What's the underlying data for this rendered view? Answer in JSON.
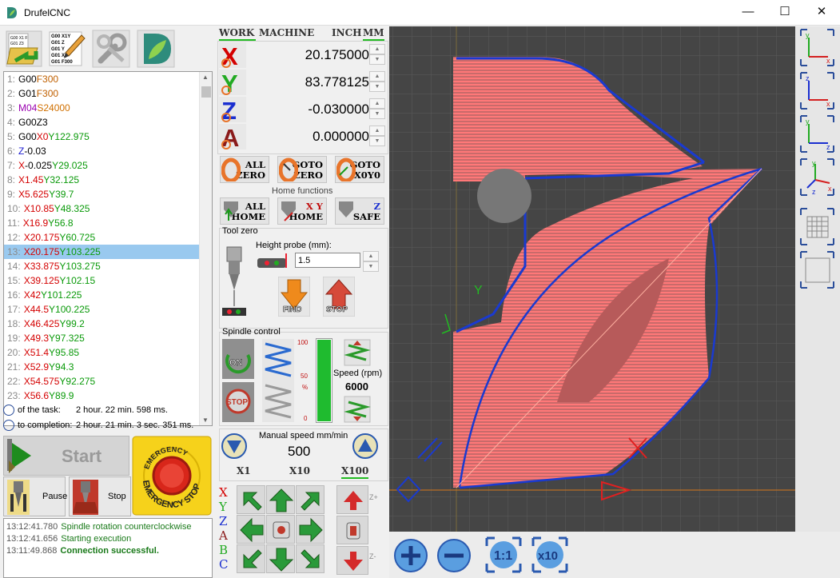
{
  "app": {
    "title": "DrufelCNC"
  },
  "window": {
    "minimize": "—",
    "maximize": "☐",
    "close": "✕"
  },
  "toolbar": {
    "open_icon": "open-gcode-icon",
    "edit_icon": "edit-gcode-icon",
    "settings_icon": "settings-wrench-icon",
    "about_icon": "drufel-logo-icon"
  },
  "gcode": {
    "lines": [
      {
        "n": "1:",
        "parts": [
          [
            "G",
            "G00"
          ],
          [
            "F",
            "F300"
          ]
        ]
      },
      {
        "n": "2:",
        "parts": [
          [
            "G",
            "G01"
          ],
          [
            "F",
            "F300"
          ]
        ]
      },
      {
        "n": "3:",
        "parts": [
          [
            "M",
            "M04"
          ],
          [
            "S",
            "S24000"
          ]
        ]
      },
      {
        "n": "4:",
        "parts": [
          [
            "G",
            "G00Z3"
          ]
        ]
      },
      {
        "n": "5:",
        "parts": [
          [
            "G",
            "G00"
          ],
          [
            "X",
            "X0"
          ],
          [
            "Y",
            "Y122.975"
          ]
        ]
      },
      {
        "n": "6:",
        "parts": [
          [
            "Z",
            "Z"
          ],
          [
            "G",
            "-0.03"
          ]
        ]
      },
      {
        "n": "7:",
        "parts": [
          [
            "X",
            "X"
          ],
          [
            "G",
            "-0.025"
          ],
          [
            "Y",
            "Y29.025"
          ]
        ]
      },
      {
        "n": "8:",
        "parts": [
          [
            "X",
            "X1.45"
          ],
          [
            "Y",
            "Y32.125"
          ]
        ]
      },
      {
        "n": "9:",
        "parts": [
          [
            "X",
            "X5.625"
          ],
          [
            "Y",
            "Y39.7"
          ]
        ]
      },
      {
        "n": "10:",
        "parts": [
          [
            "X",
            "X10.85"
          ],
          [
            "Y",
            "Y48.325"
          ]
        ]
      },
      {
        "n": "11:",
        "parts": [
          [
            "X",
            "X16.9"
          ],
          [
            "Y",
            "Y56.8"
          ]
        ]
      },
      {
        "n": "12:",
        "parts": [
          [
            "X",
            "X20.175"
          ],
          [
            "Y",
            "Y60.725"
          ]
        ]
      },
      {
        "n": "13:",
        "parts": [
          [
            "X",
            "X20.175"
          ],
          [
            "Y",
            "Y103.225"
          ]
        ]
      },
      {
        "n": "14:",
        "parts": [
          [
            "X",
            "X33.875"
          ],
          [
            "Y",
            "Y103.275"
          ]
        ]
      },
      {
        "n": "15:",
        "parts": [
          [
            "X",
            "X39.125"
          ],
          [
            "Y",
            "Y102.15"
          ]
        ]
      },
      {
        "n": "16:",
        "parts": [
          [
            "X",
            "X42"
          ],
          [
            "Y",
            "Y101.225"
          ]
        ]
      },
      {
        "n": "17:",
        "parts": [
          [
            "X",
            "X44.5"
          ],
          [
            "Y",
            "Y100.225"
          ]
        ]
      },
      {
        "n": "18:",
        "parts": [
          [
            "X",
            "X46.425"
          ],
          [
            "Y",
            "Y99.2"
          ]
        ]
      },
      {
        "n": "19:",
        "parts": [
          [
            "X",
            "X49.3"
          ],
          [
            "Y",
            "Y97.325"
          ]
        ]
      },
      {
        "n": "20:",
        "parts": [
          [
            "X",
            "X51.4"
          ],
          [
            "Y",
            "Y95.85"
          ]
        ]
      },
      {
        "n": "21:",
        "parts": [
          [
            "X",
            "X52.9"
          ],
          [
            "Y",
            "Y94.3"
          ]
        ]
      },
      {
        "n": "22:",
        "parts": [
          [
            "X",
            "X54.575"
          ],
          [
            "Y",
            "Y92.275"
          ]
        ]
      },
      {
        "n": "23:",
        "parts": [
          [
            "X",
            "X56.6"
          ],
          [
            "Y",
            "Y89.9"
          ]
        ]
      }
    ],
    "selected_index": 12
  },
  "timing": {
    "task_label": "of the task:",
    "task_value": "2 hour.  22 min.  598 ms.",
    "completion_label": "to completion:",
    "completion_value": "2 hour.  21 min.  3 sec.  351 ms."
  },
  "controls": {
    "start": "Start",
    "pause": "Pause",
    "stop": "Stop",
    "estop_top": "EMERGENCY",
    "estop_mid": "STOP",
    "estop_bottom": "EMERGENCY STOP"
  },
  "log": [
    {
      "time": "13:12:41.780",
      "text": "Spindle rotation counterclockwise",
      "bold": false
    },
    {
      "time": "13:12:41.656",
      "text": "Starting execution",
      "bold": false
    },
    {
      "time": "13:11:49.868",
      "text": "Connection successful.",
      "bold": true
    }
  ],
  "coords": {
    "tabs": {
      "work": "WORK",
      "machine": "MACHINE",
      "inch": "INCH",
      "mm": "MM"
    },
    "axes": [
      {
        "axis": "X",
        "value": "20.175000",
        "color": "#d40000"
      },
      {
        "axis": "Y",
        "value": "83.778125",
        "color": "#22aa22"
      },
      {
        "axis": "Z",
        "value": "-0.030000",
        "color": "#1b2fd0"
      },
      {
        "axis": "A",
        "value": "0.000000",
        "color": "#8a1a1a"
      }
    ]
  },
  "zero": {
    "all_zero": [
      "ALL",
      "ZERO"
    ],
    "goto_zero": [
      "GOTO",
      "ZERO"
    ],
    "goto_x0y0": [
      "GOTO",
      "X0Y0"
    ],
    "home_title": "Home functions",
    "all_home": [
      "ALL",
      "HOME"
    ],
    "xy_home": [
      "X Y",
      "HOME"
    ],
    "z_safe": [
      "Z",
      "SAFE"
    ]
  },
  "toolzero": {
    "title": "Tool zero",
    "probe_label": "Height probe (mm):",
    "probe_value": "1.5",
    "find": "FIND",
    "stop": "STOP"
  },
  "spindle": {
    "title": "Spindle control",
    "on": "ON",
    "stop": "STOP",
    "scale_top": "100",
    "scale_mid": "50",
    "scale_pct": "%",
    "scale_bottom": "0",
    "speed_label": "Speed (rpm)",
    "speed_value": "6000",
    "level_fraction": 1.0
  },
  "manual": {
    "label": "Manual speed mm/min",
    "value": "500",
    "x1": "X1",
    "x10": "X10",
    "x100": "X100",
    "selected": "X100"
  },
  "jog": {
    "axes_letters": [
      "X",
      "Y",
      "Z",
      "A",
      "B",
      "C"
    ],
    "zplus": "Z+",
    "zminus": "Z-"
  },
  "zoom": {
    "plus": "+",
    "minus": "−",
    "one": "1:1",
    "ten": "x10"
  },
  "viewport": {
    "y_axis_label": "Y"
  },
  "views": [
    "view-xy-icon",
    "view-xz-icon",
    "view-yz-icon",
    "view-3d-icon",
    "grid-toggle-icon",
    "frame-toggle-icon"
  ],
  "colors": {
    "accent_green": "#22bb22",
    "toolpath": "#ff6e6e",
    "contour": "#1a3ad0",
    "viewport_bg": "#454545"
  }
}
